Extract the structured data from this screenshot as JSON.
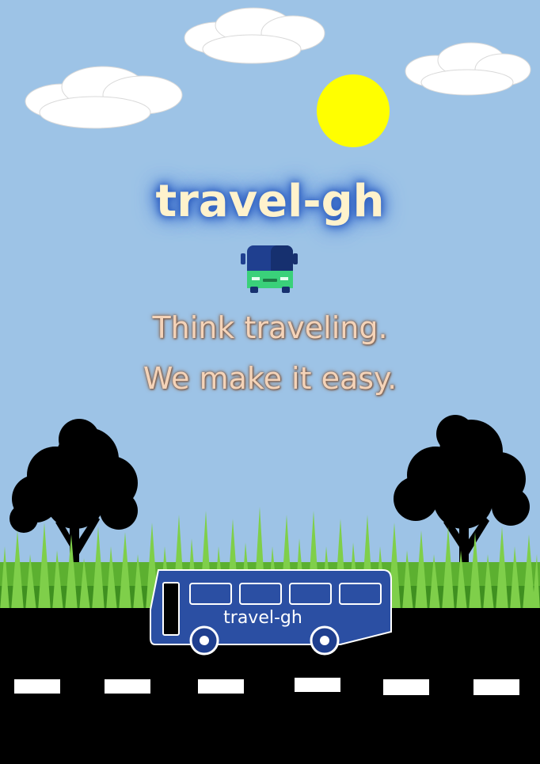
{
  "brand": {
    "title": "travel-gh",
    "bus_label": "travel-gh"
  },
  "tagline": {
    "line1": "Think traveling.",
    "line2": "We make it easy."
  },
  "icons": {
    "bus_icon": "bus-front-icon",
    "sun": "sun-icon",
    "clouds": "cloud-icon",
    "trees": "tree-silhouette"
  },
  "colors": {
    "sky": "#9dc3e6",
    "sun": "#ffff00",
    "title_text": "#fff2cc",
    "title_glow": "#2f5fbf",
    "tagline_text": "#f4d3b8",
    "bus_body": "#2b4fa3",
    "road": "#000000",
    "grass": "#5cb030",
    "lane_marks": "#ffffff"
  }
}
